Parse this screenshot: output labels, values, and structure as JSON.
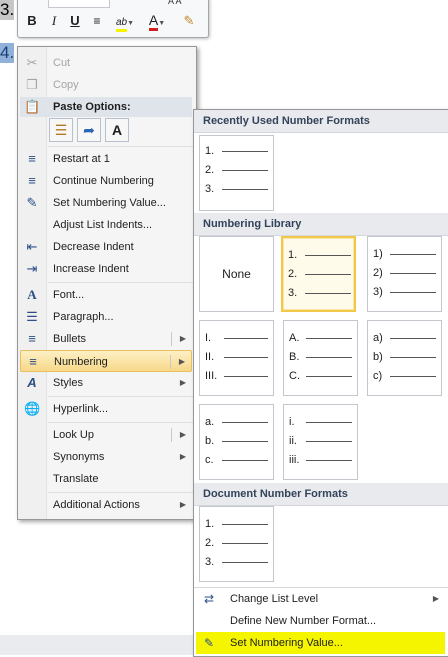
{
  "document": {
    "line3": "3.",
    "line4": "4."
  },
  "mini_toolbar": {
    "bold": "B",
    "italic": "I",
    "underline": "U",
    "highlight": "ab",
    "font_color": "A",
    "top_letters": "A A"
  },
  "context_menu": {
    "cut": "Cut",
    "copy": "Copy",
    "paste_options": "Paste Options:",
    "paste_text_only": "A",
    "restart_at_1": "Restart at 1",
    "continue_numbering": "Continue Numbering",
    "set_numbering_value": "Set Numbering Value...",
    "adjust_list_indents": "Adjust List Indents...",
    "decrease_indent": "Decrease Indent",
    "increase_indent": "Increase Indent",
    "font": "Font...",
    "paragraph": "Paragraph...",
    "bullets": "Bullets",
    "numbering": "Numbering",
    "styles": "Styles",
    "hyperlink": "Hyperlink...",
    "look_up": "Look Up",
    "synonyms": "Synonyms",
    "translate": "Translate",
    "additional_actions": "Additional Actions"
  },
  "numbering_panel": {
    "recent_header": "Recently Used Number Formats",
    "library_header": "Numbering Library",
    "document_header": "Document Number Formats",
    "none_label": "None",
    "recent_format": [
      "1.",
      "2.",
      "3."
    ],
    "library": {
      "arabic_period": [
        "1.",
        "2.",
        "3."
      ],
      "arabic_paren": [
        "1)",
        "2)",
        "3)"
      ],
      "roman_upper": [
        "I.",
        "II.",
        "III."
      ],
      "alpha_upper": [
        "A.",
        "B.",
        "C."
      ],
      "alpha_paren": [
        "a)",
        "b)",
        "c)"
      ],
      "alpha_lower": [
        "a.",
        "b.",
        "c."
      ],
      "roman_lower": [
        "i.",
        "ii.",
        "iii."
      ]
    },
    "document_format": [
      "1.",
      "2.",
      "3."
    ],
    "change_list_level": "Change List Level",
    "define_new_number_format": "Define New Number Format...",
    "set_numbering_value": "Set Numbering Value..."
  },
  "colors": {
    "highlight_yellow": "#f5f500",
    "selection_gold": "#f2c84b",
    "menu_hover": "#f7d88a"
  }
}
